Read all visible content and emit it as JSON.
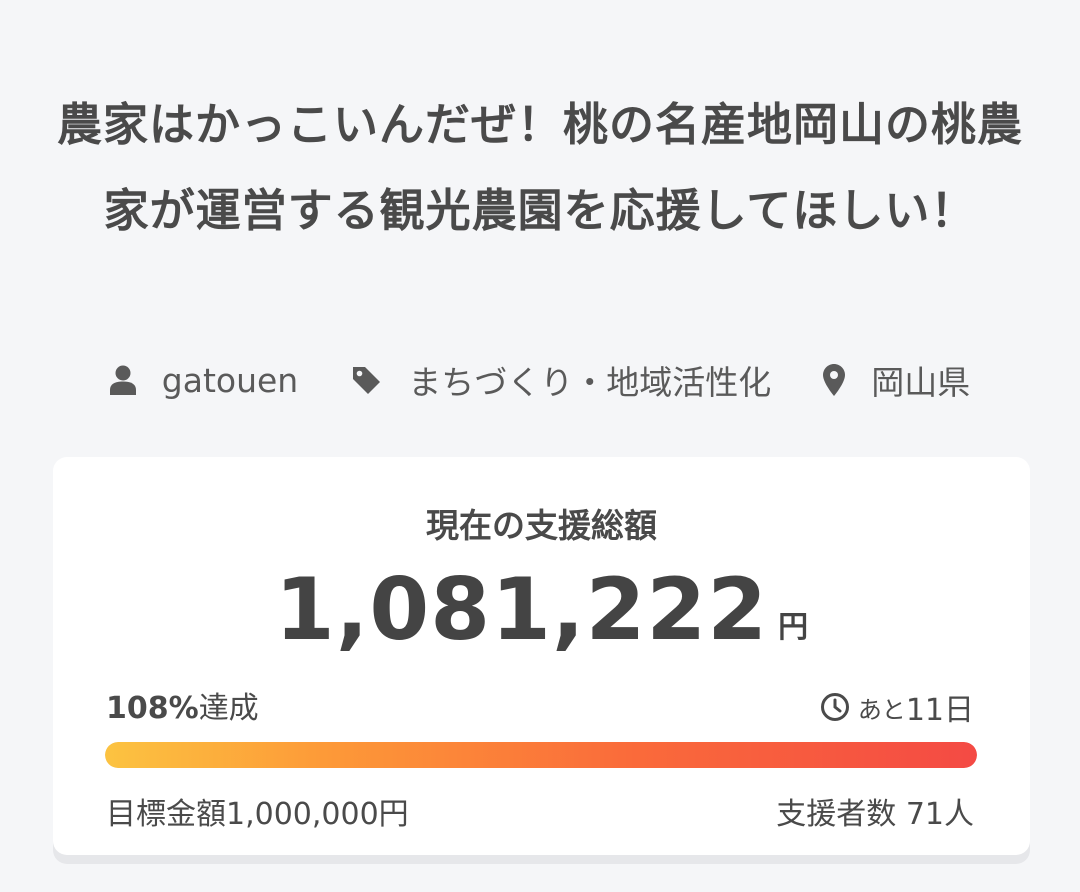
{
  "project": {
    "title": "農家はかっこいんだぜ！桃の名産地岡山の桃農家が運営する観光農園を応援してほしい！",
    "owner": "gatouen",
    "category": "まちづくり・地域活性化",
    "location": "岡山県"
  },
  "icons": {
    "owner": "user-icon",
    "category": "tag-icon",
    "location": "map-pin-icon",
    "remaining": "clock-icon"
  },
  "funding": {
    "label": "現在の支援総額",
    "amount": "1,081,222",
    "currency": "円",
    "achievement_percent": "108%",
    "achievement_suffix": "達成",
    "progress_fraction": 1.0,
    "remaining_prefix": "あと",
    "remaining_value": "11日",
    "goal": "目標金額1,000,000円",
    "backers": "支援者数 71人"
  },
  "colors": {
    "background": "#f5f6f8",
    "card": "#ffffff",
    "text": "#4a4a4a",
    "icon": "#5a5a5a",
    "progress_start": "#fcc341",
    "progress_end": "#f44a44"
  }
}
